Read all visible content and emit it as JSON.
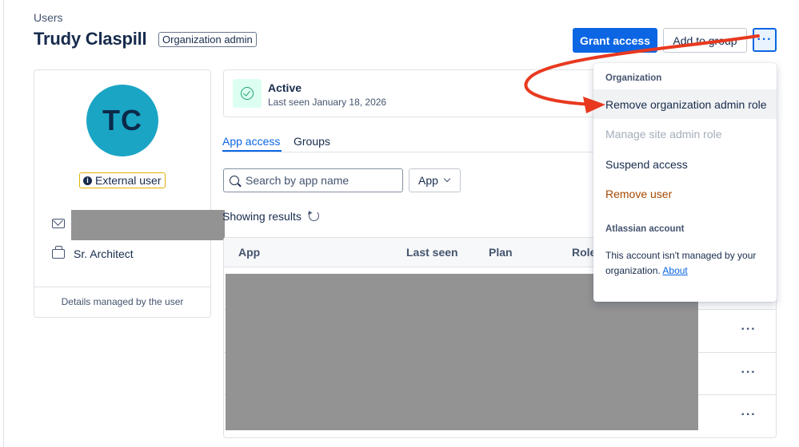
{
  "header": {
    "breadcrumb": "Users",
    "title": "Trudy Claspill",
    "role_badge": "Organization admin",
    "grant_access_label": "Grant access",
    "add_to_group_label": "Add to group",
    "more_label": "···"
  },
  "profile": {
    "initials": "TC",
    "external_badge": "External user",
    "job_title": "Sr. Architect",
    "footer_note": "Details managed by the user"
  },
  "status": {
    "label": "Active",
    "last_seen": "Last seen January 18, 2026"
  },
  "tabs": [
    {
      "label": "App access"
    },
    {
      "label": "Groups"
    }
  ],
  "search": {
    "placeholder": "Search by app name",
    "filter_label": "App"
  },
  "results_label": "Showing results",
  "table": {
    "columns": [
      "App",
      "Last seen",
      "Plan",
      "Role"
    ],
    "row_action": "···"
  },
  "menu": {
    "section_org": "Organization",
    "items": [
      {
        "label": "Remove organization admin role"
      },
      {
        "label": "Manage site admin role"
      },
      {
        "label": "Suspend access"
      },
      {
        "label": "Remove user"
      }
    ],
    "section_account": "Atlassian account",
    "note": "This account isn't managed by your organization.",
    "note_link": "About"
  },
  "colors": {
    "primary": "#0c66e4",
    "avatar": "#1ba5c5",
    "danger_text": "#a54800",
    "annotation_arrow": "#e8391f"
  }
}
